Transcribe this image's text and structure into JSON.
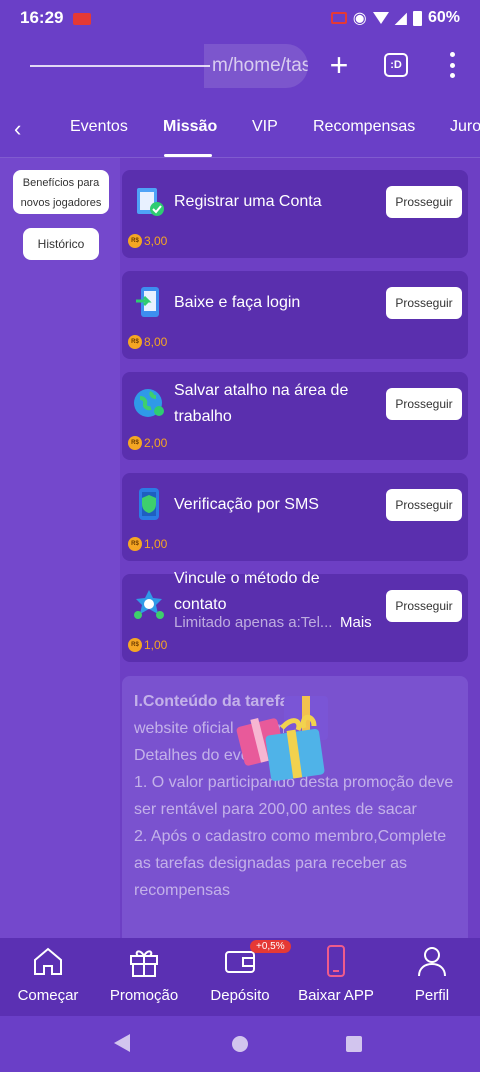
{
  "status_bar": {
    "time": "16:29",
    "battery": "60%"
  },
  "browser": {
    "url_text": "m/home/tas",
    "plus": "+",
    "tab_label": ":D"
  },
  "tabs": {
    "back": "‹",
    "items": [
      "Eventos",
      "Missão",
      "VIP",
      "Recompensas",
      "Juros"
    ],
    "active": "Missão"
  },
  "sidebar": {
    "new_players_line1": "Benefícios para",
    "new_players_line2": "novos jogadores",
    "history": "Histórico"
  },
  "missions": [
    {
      "title": "Registrar uma Conta",
      "reward": "3,00",
      "button": "Prosseguir",
      "icon": "clipboard-check-icon"
    },
    {
      "title": "Baixe e faça login",
      "reward": "8,00",
      "button": "Prosseguir",
      "icon": "phone-download-icon"
    },
    {
      "title": "Salvar atalho na área de trabalho",
      "reward": "2,00",
      "button": "Prosseguir",
      "icon": "globe-icon"
    },
    {
      "title": "Verificação por SMS",
      "reward": "1,00",
      "button": "Prosseguir",
      "icon": "shield-phone-icon"
    },
    {
      "title": "Vincule o método de contato",
      "subtitle": "Limitado apenas a:Tel...",
      "more": "Mais",
      "reward": "1,00",
      "button": "Prosseguir",
      "icon": "contact-icon"
    }
  ],
  "currency": "R$",
  "info": {
    "heading": "I.Conteúdo da tarefa:",
    "lines": [
      "website oficial ... .com",
      "Detalhes do evento:",
      "1. O valor participando desta promoção deve ser rentável para 200,00 antes de sacar",
      "2. Após o cadastro como membro,Complete as tarefas designadas para receber as recompensas"
    ]
  },
  "bottom_nav": {
    "items": [
      {
        "label": "Começar",
        "icon": "home-icon"
      },
      {
        "label": "Promoção",
        "icon": "gift-icon"
      },
      {
        "label": "Depósito",
        "icon": "wallet-icon"
      },
      {
        "label": "Baixar APP",
        "icon": "phone-icon"
      },
      {
        "label": "Perfil",
        "icon": "user-icon"
      }
    ],
    "badge": "+0,5%"
  },
  "colors": {
    "accent": "#6a3fc7",
    "card": "#5a2fae",
    "reward": "#f5a623"
  }
}
